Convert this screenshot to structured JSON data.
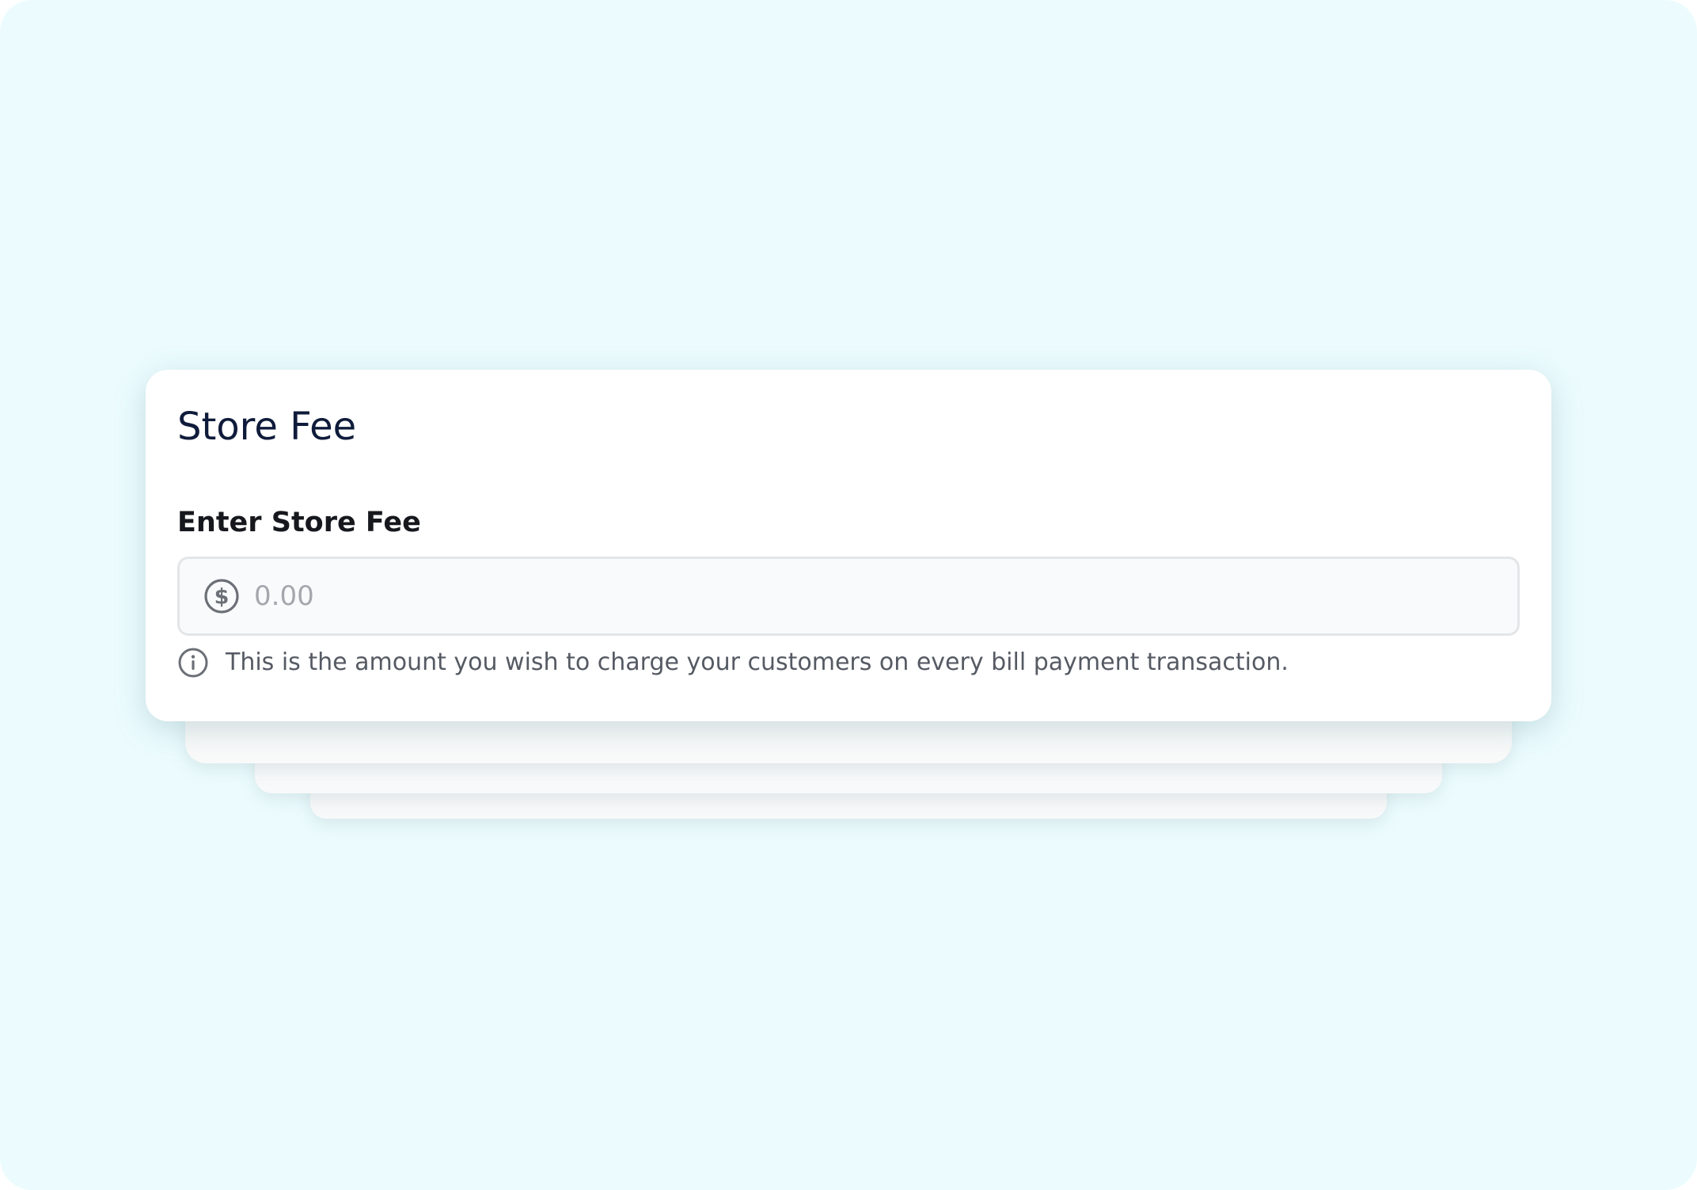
{
  "colors": {
    "background": "#ecfcfe",
    "card": "#ffffff",
    "title": "#0f1b3a",
    "label": "#16181d",
    "hint": "#555a63",
    "placeholder": "#a4a7ad",
    "icon": "#6b6f76",
    "input_border": "#e3e5e8",
    "input_background": "#f9fafb"
  },
  "card": {
    "title": "Store Fee"
  },
  "store_fee_field": {
    "label": "Enter Store Fee",
    "value": "",
    "placeholder": "0.00",
    "leading_icon": "dollar-circle-icon",
    "hint_icon": "info-circle-icon",
    "hint": "This is the amount you wish to charge your customers on every bill payment transaction."
  }
}
